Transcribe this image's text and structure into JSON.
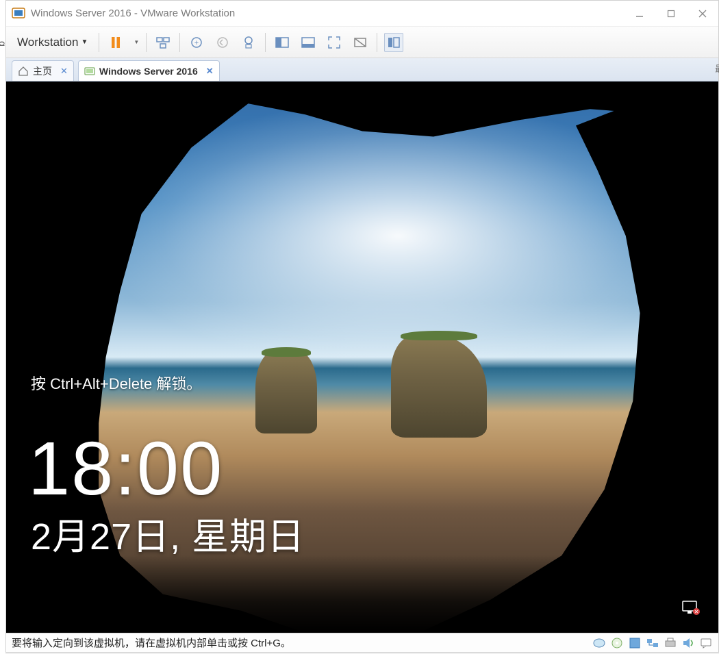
{
  "window": {
    "title": "Windows Server 2016 - VMware Workstation"
  },
  "toolbar": {
    "menu_label": "Workstation"
  },
  "tabs": [
    {
      "label": "主页",
      "icon": "home-icon",
      "active": false
    },
    {
      "label": "Windows Server 2016",
      "icon": "vm-icon",
      "active": true
    }
  ],
  "lockscreen": {
    "unlock_hint": "按 Ctrl+Alt+Delete 解锁。",
    "time": "18:00",
    "date": "2月27日, 星期日"
  },
  "statusbar": {
    "message": "要将输入定向到该虚拟机，请在虚拟机内部单击或按 Ctrl+G。"
  },
  "sliver_left": "g",
  "sliver_right": "最"
}
